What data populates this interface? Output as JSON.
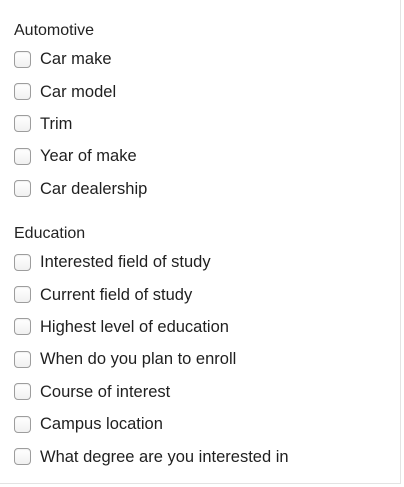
{
  "groups": [
    {
      "title": "Automotive",
      "options": [
        {
          "label": "Car make",
          "checked": false
        },
        {
          "label": "Car model",
          "checked": false
        },
        {
          "label": "Trim",
          "checked": false
        },
        {
          "label": "Year of make",
          "checked": false
        },
        {
          "label": "Car dealership",
          "checked": false
        }
      ]
    },
    {
      "title": "Education",
      "options": [
        {
          "label": "Interested field of study",
          "checked": false
        },
        {
          "label": "Current field of study",
          "checked": false
        },
        {
          "label": "Highest level of education",
          "checked": false
        },
        {
          "label": "When do you plan to enroll",
          "checked": false
        },
        {
          "label": "Course of interest",
          "checked": false
        },
        {
          "label": "Campus location",
          "checked": false
        },
        {
          "label": "What degree are you interested in",
          "checked": false
        }
      ]
    }
  ]
}
